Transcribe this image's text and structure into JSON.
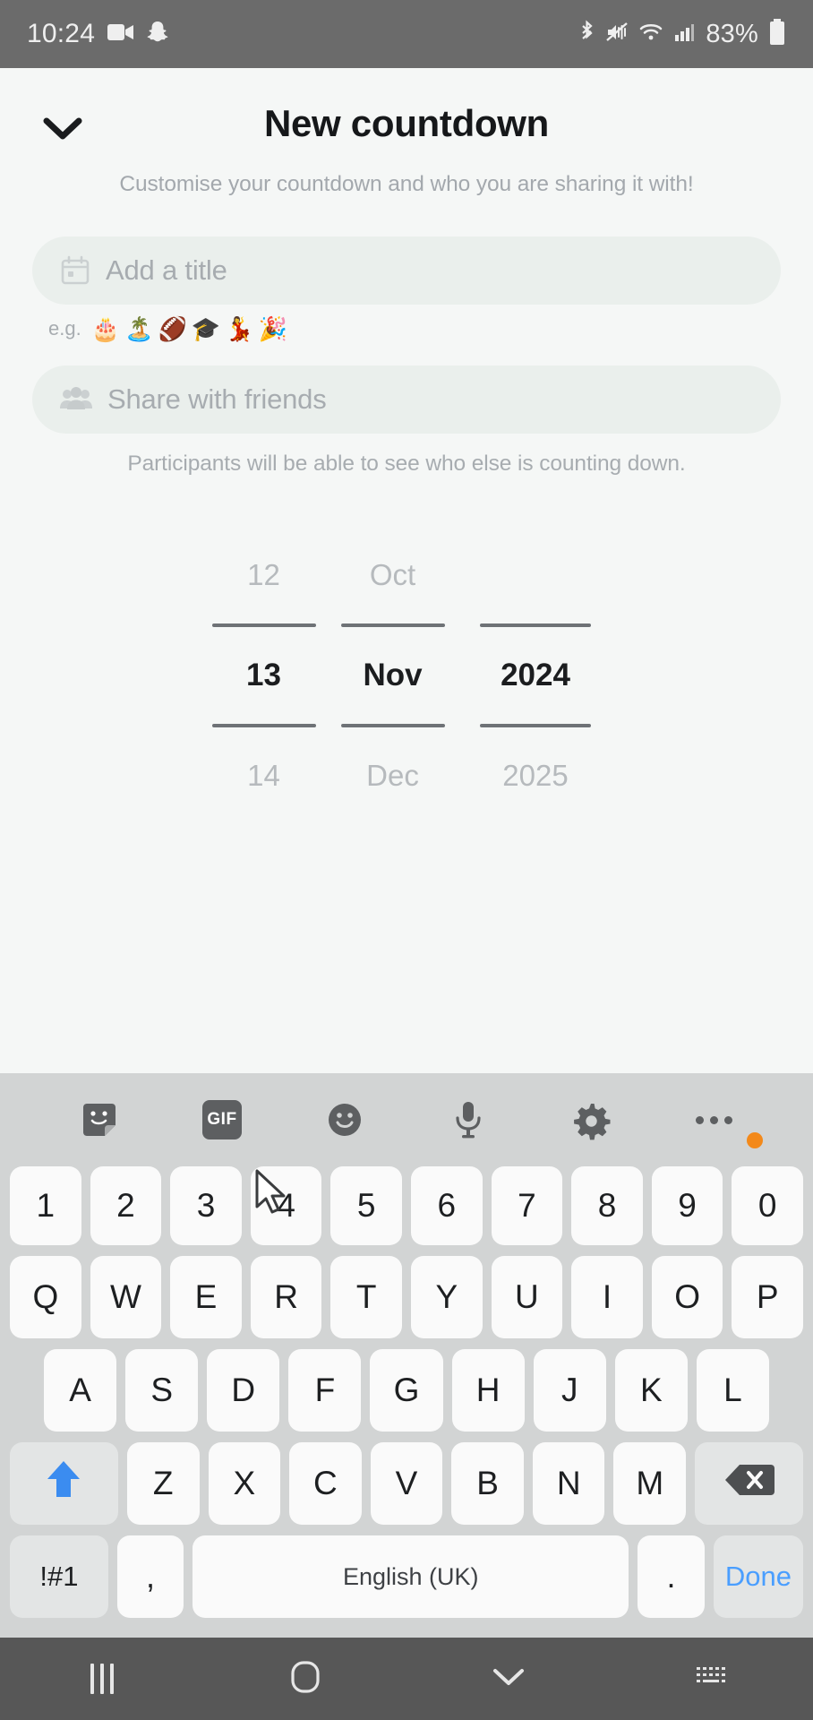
{
  "status_bar": {
    "time": "10:24",
    "battery_percent": "83%",
    "left_icons": [
      "video-camera-icon",
      "snapchat-ghost-icon"
    ],
    "right_icons": [
      "bluetooth-icon",
      "mute-vibrate-icon",
      "wifi-icon",
      "cellular-signal-icon"
    ]
  },
  "sheet": {
    "back_icon": "chevron-down-icon",
    "title": "New countdown",
    "subtitle": "Customise your countdown and who you are sharing it with!",
    "title_field": {
      "icon": "calendar-icon",
      "placeholder": "Add a title",
      "value": ""
    },
    "examples": {
      "label": "e.g.",
      "emojis": [
        "🎂",
        "🏝️",
        "🏈",
        "🎓",
        "💃",
        "🎉"
      ]
    },
    "share_field": {
      "icon": "people-group-icon",
      "placeholder": "Share with friends",
      "value": ""
    },
    "helper_text": "Participants will be able to see who else is counting down.",
    "date_picker": {
      "day": {
        "previous": "12",
        "selected": "13",
        "next": "14"
      },
      "month": {
        "previous": "Oct",
        "selected": "Nov",
        "next": "Dec"
      },
      "year": {
        "previous": "",
        "selected": "2024",
        "next": "2025"
      }
    }
  },
  "keyboard": {
    "toolbar": [
      {
        "name": "sticker-icon"
      },
      {
        "name": "gif-icon",
        "label": "GIF"
      },
      {
        "name": "emoji-smiley-icon"
      },
      {
        "name": "microphone-icon"
      },
      {
        "name": "settings-gear-icon"
      },
      {
        "name": "more-options-icon"
      }
    ],
    "row_numbers": [
      "1",
      "2",
      "3",
      "4",
      "5",
      "6",
      "7",
      "8",
      "9",
      "0"
    ],
    "row_top": [
      "Q",
      "W",
      "E",
      "R",
      "T",
      "Y",
      "U",
      "I",
      "O",
      "P"
    ],
    "row_home": [
      "A",
      "S",
      "D",
      "F",
      "G",
      "H",
      "J",
      "K",
      "L"
    ],
    "row_bottom": [
      "Z",
      "X",
      "C",
      "V",
      "B",
      "N",
      "M"
    ],
    "shift_icon": "shift-arrow-up-icon",
    "backspace_icon": "backspace-delete-icon",
    "symbols_key": "!#1",
    "comma_key": ",",
    "space_key": "English (UK)",
    "period_key": ".",
    "done_key": "Done",
    "accent_color": "#4a9eff",
    "shift_color": "#3b8cf0"
  },
  "nav_bar": {
    "recents": "recents-icon",
    "home": "home-icon",
    "dismiss_keyboard": "chevron-down-icon",
    "keyboard_switch": "keyboard-switch-icon"
  }
}
